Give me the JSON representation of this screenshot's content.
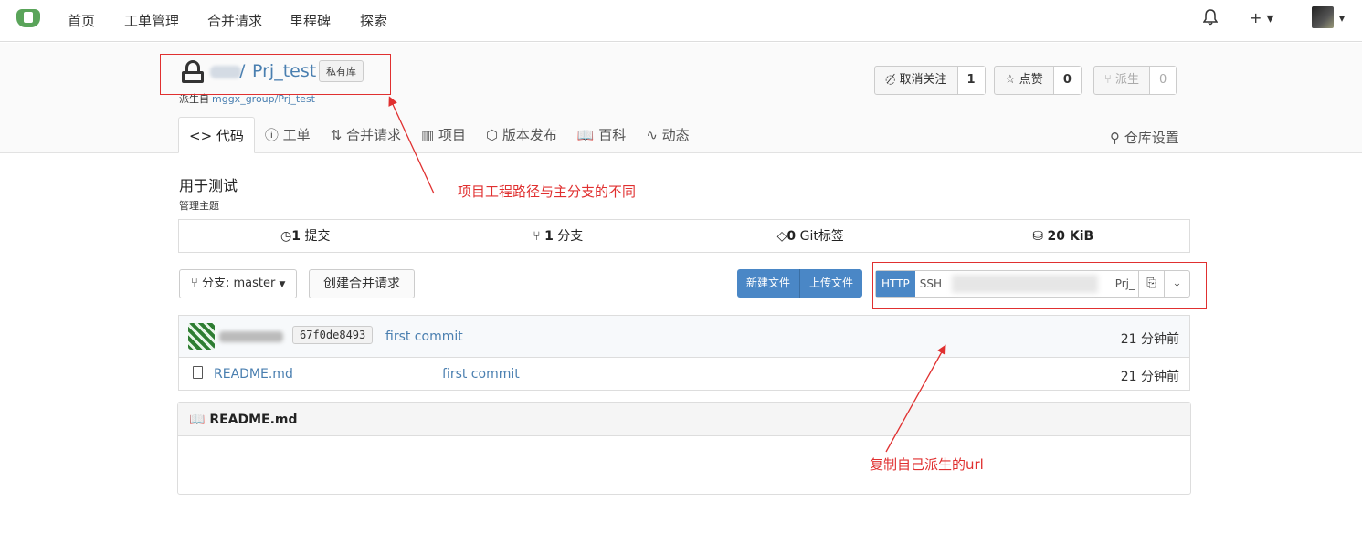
{
  "topnav": {
    "items": [
      "首页",
      "工单管理",
      "合并请求",
      "里程碑",
      "探索"
    ],
    "bell_icon": "bell-icon",
    "plus_label": "+ ▾",
    "avatar_caret": "▾"
  },
  "repo": {
    "name": "Prj_test",
    "visibility_badge": "私有库",
    "forked_from_label": "派生自",
    "forked_from_link": "mggx_group/Prj_test"
  },
  "actions": {
    "watch_label": "取消关注",
    "watch_count": "1",
    "star_label": "点赞",
    "star_count": "0",
    "fork_label": "派生",
    "fork_count": "0"
  },
  "tabs": [
    "<> 代码",
    "ⓘ 工单",
    "⇅ 合并请求",
    "▥ 项目",
    "⬡ 版本发布",
    "📖 百科",
    "∿ 动态"
  ],
  "settings_tab": "仓库设置",
  "description": "用于测试",
  "manage_topics": "管理主题",
  "stats": {
    "commits_num": "1",
    "commits_label": "提交",
    "branches_num": "1",
    "branches_label": "分支",
    "tags_num": "0",
    "tags_label": "Git标签",
    "size": "20 KiB"
  },
  "toolbar": {
    "branch_label": "分支: master",
    "new_pr": "创建合并请求",
    "new_file": "新建文件",
    "upload_file": "上传文件",
    "clone_http": "HTTP",
    "clone_ssh": "SSH",
    "clone_url_tail": "Prj_"
  },
  "latest_commit": {
    "sha": "67f0de8493",
    "message": "first commit",
    "time": "21 分钟前"
  },
  "files": [
    {
      "name": "README.md",
      "message": "first commit",
      "time": "21 分钟前"
    }
  ],
  "readme_title": "README.md",
  "annotations": {
    "note_top": "项目工程路径与主分支的不同",
    "note_bottom": "复制自己派生的url",
    "color": "#e03030"
  }
}
